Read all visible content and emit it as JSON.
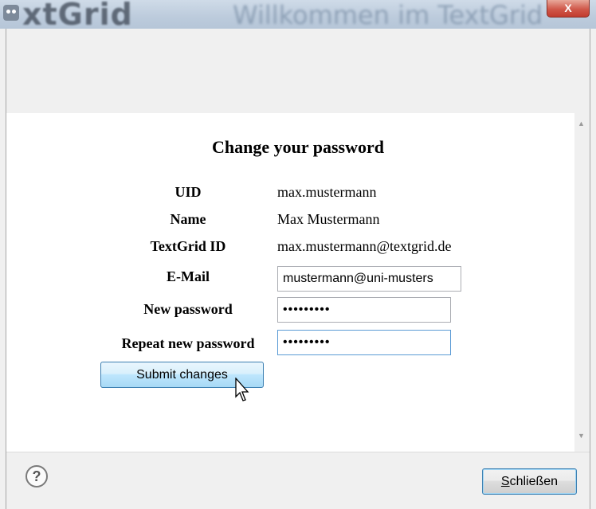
{
  "titlebar": {
    "app_name": "xtGrid",
    "window_title": "Willkommen im TextGrid",
    "close_glyph": "X"
  },
  "form": {
    "heading": "Change your password",
    "uid_label": "UID",
    "uid_value": "max.mustermann",
    "name_label": "Name",
    "name_value": "Max Mustermann",
    "textgrid_id_label": "TextGrid ID",
    "textgrid_id_value": "max.mustermann@textgrid.de",
    "email_label": "E-Mail",
    "email_value": "mustermann@uni-musters",
    "new_password_label": "New password",
    "new_password_value": "•••••••••",
    "repeat_password_label": "Repeat new password",
    "repeat_password_value": "•••••••••",
    "submit_label": "Submit changes"
  },
  "footer": {
    "help_glyph": "?",
    "close_label_mnemonic": "S",
    "close_label_rest": "chließen"
  },
  "icons": [
    "app-logo-icon",
    "close-icon",
    "scroll-up-arrow-icon",
    "scroll-down-arrow-icon",
    "mouse-cursor-icon",
    "help-icon"
  ]
}
